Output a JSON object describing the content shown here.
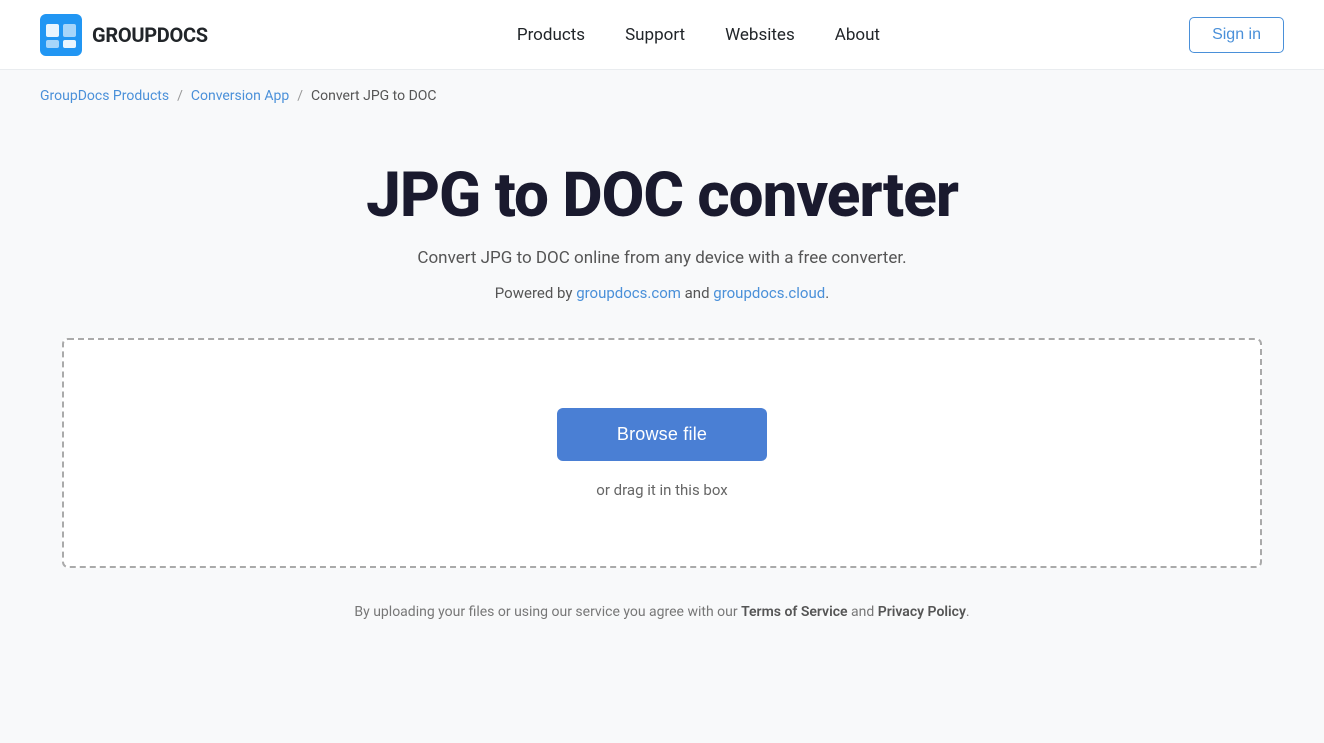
{
  "header": {
    "logo_text": "GROUPDOCS",
    "nav": {
      "items": [
        {
          "label": "Products",
          "id": "products"
        },
        {
          "label": "Support",
          "id": "support"
        },
        {
          "label": "Websites",
          "id": "websites"
        },
        {
          "label": "About",
          "id": "about"
        }
      ],
      "sign_in_label": "Sign in"
    }
  },
  "breadcrumb": {
    "items": [
      {
        "label": "GroupDocs Products",
        "id": "groupdocs-products"
      },
      {
        "label": "Conversion App",
        "id": "conversion-app"
      },
      {
        "label": "Convert JPG to DOC",
        "id": "convert-jpg-to-doc"
      }
    ],
    "separator": "/"
  },
  "main": {
    "title": "JPG to DOC converter",
    "subtitle": "Convert JPG to DOC online from any device with a free converter.",
    "powered_by_prefix": "Powered by ",
    "powered_by_link1_label": "groupdocs.com",
    "powered_by_link1_url": "https://groupdocs.com",
    "powered_by_and": " and ",
    "powered_by_link2_label": "groupdocs.cloud",
    "powered_by_link2_url": "https://groupdocs.cloud",
    "powered_by_suffix": ".",
    "drop_zone": {
      "browse_label": "Browse file",
      "drag_text": "or drag it in this box"
    }
  },
  "footer_note": {
    "prefix": "By uploading your files or using our service you agree with our ",
    "tos_label": "Terms of Service",
    "and": " and ",
    "privacy_label": "Privacy Policy",
    "suffix": "."
  },
  "colors": {
    "accent": "#4a7fd4",
    "link": "#4a90d9"
  }
}
